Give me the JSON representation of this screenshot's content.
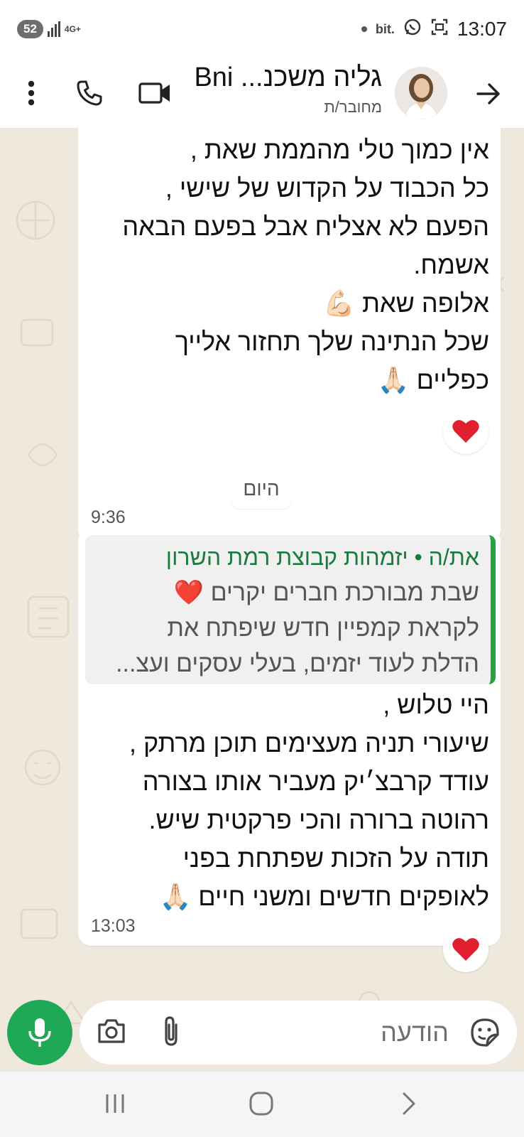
{
  "status_bar": {
    "notification_count": "52",
    "network": "4G+",
    "bit_label": "bit.",
    "time": "13:07"
  },
  "header": {
    "title": "גליה משכנ... Bni",
    "subtitle": "מחובר/ת"
  },
  "messages": [
    {
      "lines": [
        "אין כמוך טלי מהממת שאת ,",
        "כל הכבוד על הקדוש של שישי ,",
        "הפעם לא אצליח אבל בפעם הבאה",
        "אשמח.",
        "אלופה שאת 💪🏻",
        "שכל הנתינה שלך תחזור אלייך",
        "כפליים 🙏🏻"
      ],
      "time": "9:36",
      "reaction": "❤️"
    },
    {
      "quote": {
        "author": "את/ה • יזמהות קבוצת רמת השרון",
        "lines": [
          "שבת מבורכת חברים יקרים ❤️",
          "לקראת קמפיין חדש שיפתח את",
          "הדלת לעוד יזמים, בעלי עסקים ועצ..."
        ]
      },
      "lines": [
        "היי טלוש ,",
        "שיעורי תניה מעצימים תוכן מרתק ,",
        "עודד קרבצ׳יק מעביר אותו בצורה",
        "רהוטה ברורה והכי פרקטית שיש.",
        "תודה על הזכות שפתחת בפני",
        "לאופקים חדשים ומשני חיים 🙏🏻"
      ],
      "time": "13:03",
      "reaction": "❤️"
    }
  ],
  "date_separator": "היום",
  "composer": {
    "placeholder": "הודעה"
  },
  "colors": {
    "accent": "#1fa855",
    "quote_bar": "#25a244",
    "quote_author": "#1b7a3e",
    "chat_bg": "#efe8dc"
  },
  "icons": {
    "back": "arrow-right-icon",
    "video": "video-camera-icon",
    "call": "phone-icon",
    "menu": "more-vertical-icon",
    "sticker": "sticker-icon",
    "attach": "paperclip-icon",
    "camera": "camera-icon",
    "mic": "microphone-icon"
  }
}
